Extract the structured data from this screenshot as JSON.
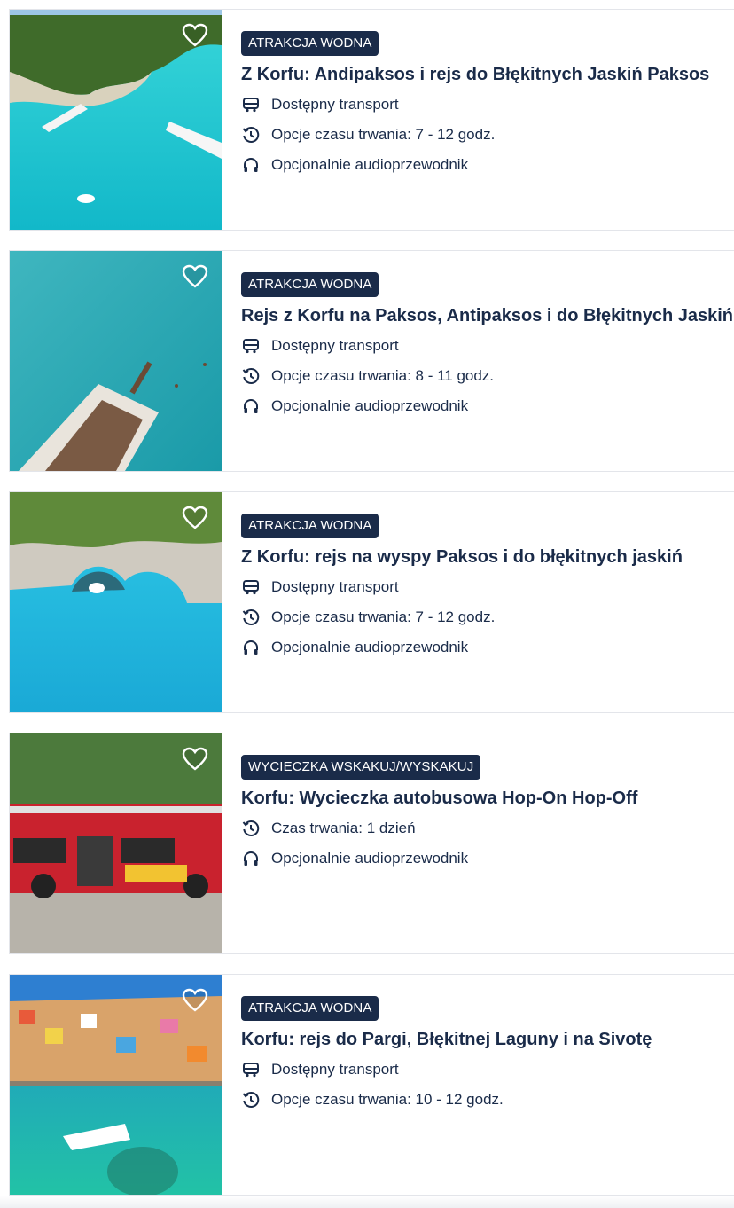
{
  "cards": [
    {
      "badge": "ATRAKCJA WODNA",
      "title": "Z Korfu: Andipaksos i rejs do Błękitnych Jaskiń Paksos",
      "features": [
        {
          "icon": "bus-icon",
          "text": "Dostępny transport"
        },
        {
          "icon": "clock-history-icon",
          "text": "Opcje czasu trwania: 7 - 12 godz."
        },
        {
          "icon": "headphones-icon",
          "text": "Opcjonalnie audioprzewodnik"
        }
      ]
    },
    {
      "badge": "ATRAKCJA WODNA",
      "title": "Rejs z Korfu na Paksos, Antipaksos i do Błękitnych Jaskiń",
      "features": [
        {
          "icon": "bus-icon",
          "text": "Dostępny transport"
        },
        {
          "icon": "clock-history-icon",
          "text": "Opcje czasu trwania: 8 - 11 godz."
        },
        {
          "icon": "headphones-icon",
          "text": "Opcjonalnie audioprzewodnik"
        }
      ]
    },
    {
      "badge": "ATRAKCJA WODNA",
      "title": "Z Korfu: rejs na wyspy Paksos i do błękitnych jaskiń",
      "features": [
        {
          "icon": "bus-icon",
          "text": "Dostępny transport"
        },
        {
          "icon": "clock-history-icon",
          "text": "Opcje czasu trwania: 7 - 12 godz."
        },
        {
          "icon": "headphones-icon",
          "text": "Opcjonalnie audioprzewodnik"
        }
      ]
    },
    {
      "badge": "WYCIECZKA WSKAKUJ/WYSKAKUJ",
      "title": "Korfu: Wycieczka autobusowa Hop-On Hop-Off",
      "features": [
        {
          "icon": "clock-history-icon",
          "text": "Czas trwania: 1 dzień"
        },
        {
          "icon": "headphones-icon",
          "text": "Opcjonalnie audioprzewodnik"
        }
      ]
    },
    {
      "badge": "ATRAKCJA WODNA",
      "title": "Korfu: rejs do Pargi, Błękitnej Laguny i na Sivotę",
      "features": [
        {
          "icon": "bus-icon",
          "text": "Dostępny transport"
        },
        {
          "icon": "clock-history-icon",
          "text": "Opcje czasu trwania: 10 - 12 godz."
        }
      ]
    }
  ]
}
